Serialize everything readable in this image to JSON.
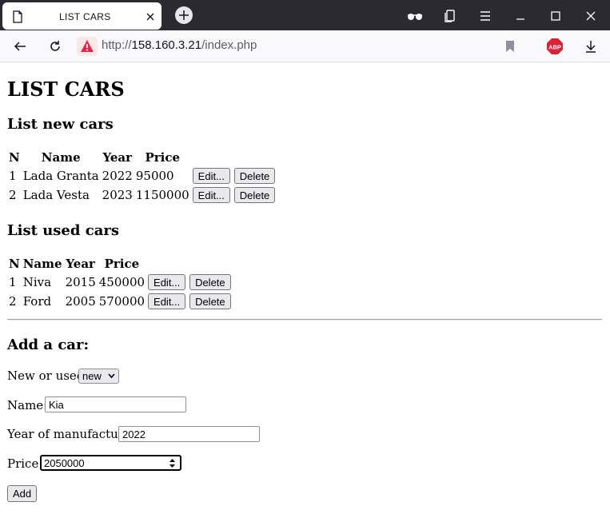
{
  "browser": {
    "tab_title": "LIST CARS",
    "url_prefix": "http://",
    "url_host": "158.160.3.21",
    "url_path": "/index.php"
  },
  "page": {
    "title": "LIST CARS",
    "new_section_title": "List new cars",
    "used_section_title": "List used cars",
    "columns": [
      "N",
      "Name",
      "Year",
      "Price"
    ],
    "new_cars": [
      {
        "n": "1",
        "name": "Lada Granta",
        "year": "2022",
        "price": "95000"
      },
      {
        "n": "2",
        "name": "Lada Vesta",
        "year": "2023",
        "price": "1150000"
      }
    ],
    "used_cars": [
      {
        "n": "1",
        "name": "Niva",
        "year": "2015",
        "price": "450000"
      },
      {
        "n": "2",
        "name": "Ford",
        "year": "2005",
        "price": "570000"
      }
    ],
    "edit_label": "Edit...",
    "delete_label": "Delete",
    "add_section_title": "Add a car:",
    "form": {
      "type_label": "New or used:",
      "type_value": "new",
      "name_label": "Name:",
      "name_value": "Kia",
      "year_label": "Year of manufacture:",
      "year_value": "2022",
      "price_label": "Price:",
      "price_value": "2050000",
      "add_label": "Add"
    }
  },
  "colors": {
    "tabbar_bg": "#2b2a33",
    "warning_red": "#e22850",
    "abp_red": "#d7233a"
  }
}
